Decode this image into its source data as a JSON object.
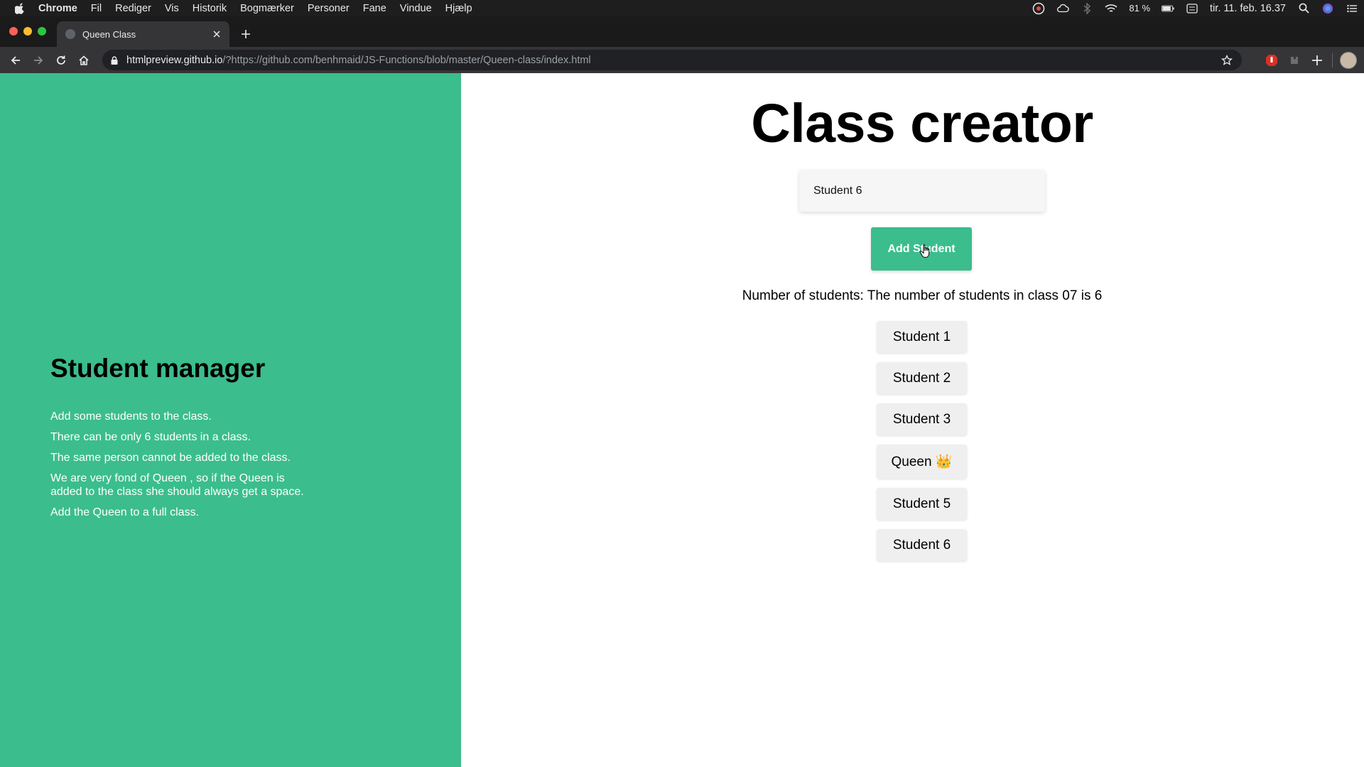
{
  "menubar": {
    "app": "Chrome",
    "items": [
      "Fil",
      "Rediger",
      "Vis",
      "Historik",
      "Bogmærker",
      "Personer",
      "Fane",
      "Vindue",
      "Hjælp"
    ],
    "battery": "81 %",
    "datetime": "tir. 11. feb. 16.37"
  },
  "browser": {
    "tab_title": "Queen Class",
    "url_host": "htmlpreview.github.io",
    "url_path": "/?https://github.com/benhmaid/JS-Functions/blob/master/Queen-class/index.html"
  },
  "sidebar": {
    "title": "Student manager",
    "lines": [
      "Add some students to the class.",
      "There can be only 6 students in a class.",
      "The same person cannot be added to the class.",
      "We are very fond of Queen , so if the Queen is added to the class she should always get a space.",
      "Add the Queen to a full class."
    ]
  },
  "main": {
    "title": "Class creator",
    "input_value": "Student 6",
    "add_button": "Add Student",
    "count_text": "Number of students: The number of students in class 07 is 6",
    "students": [
      "Student 1",
      "Student 2",
      "Student 3",
      "Queen 👑",
      "Student 5",
      "Student 6"
    ]
  },
  "colors": {
    "accent": "#3bbd8e"
  }
}
